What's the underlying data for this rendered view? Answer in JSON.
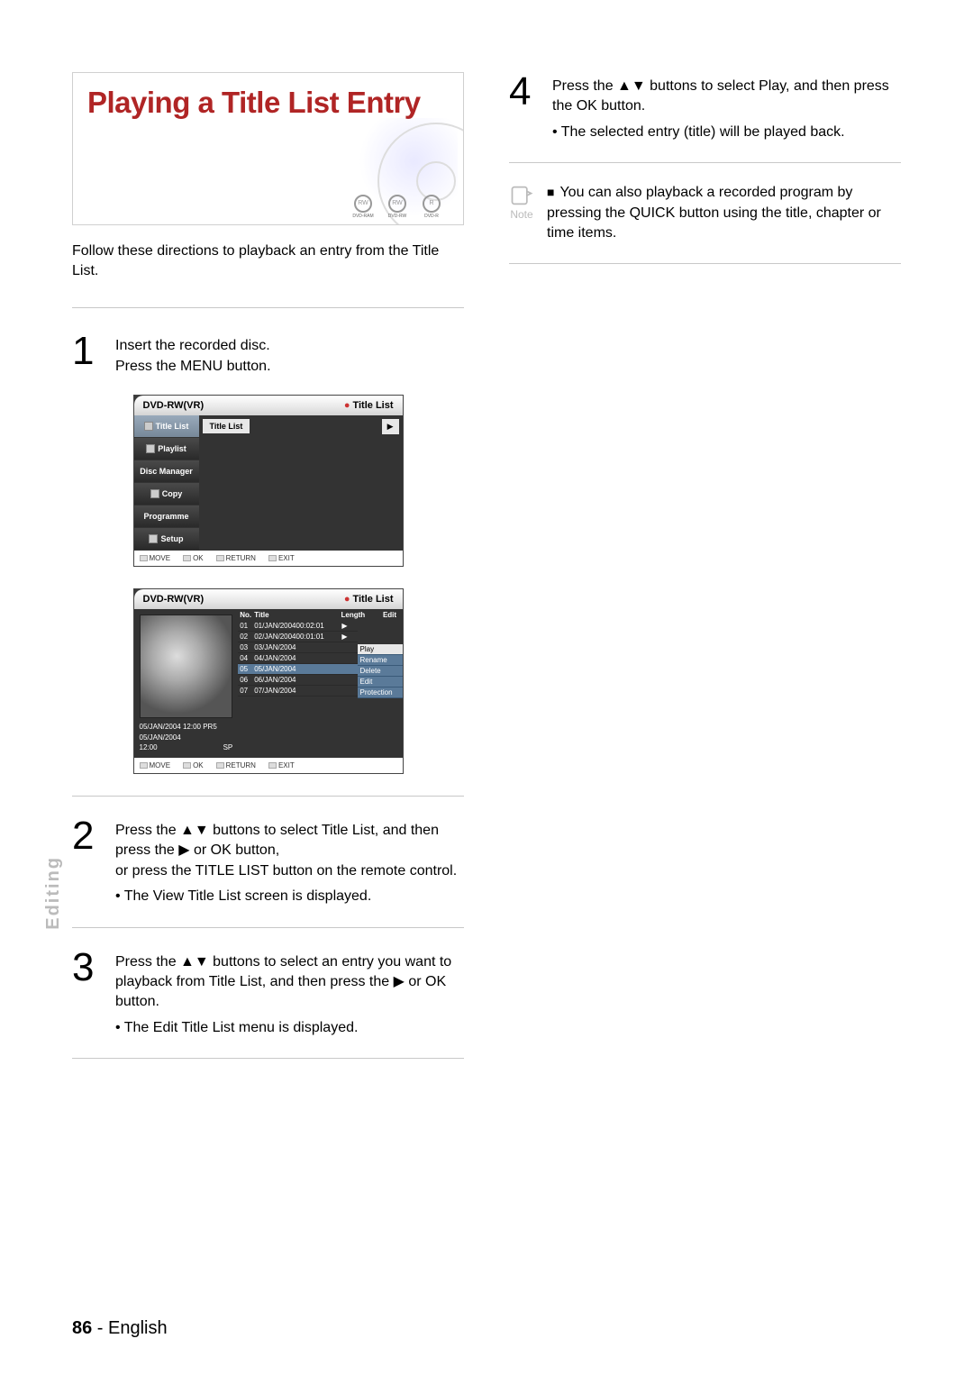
{
  "title": "Playing a Title List Entry",
  "disc_badges": [
    "DVD-RAM",
    "DVD-RW",
    "DVD-R"
  ],
  "intro": "Follow these directions to playback an entry from the Title List.",
  "steps": {
    "s1": {
      "num": "1",
      "l1": "Insert the recorded disc.",
      "l2": "Press the MENU button."
    },
    "s2": {
      "num": "2",
      "l1": "Press the ▲▼ buttons to select Title List, and then press the ▶ or OK button,",
      "l2": "or press the TITLE LIST button on the remote control.",
      "b1": "• The View Title List screen is displayed."
    },
    "s3": {
      "num": "3",
      "l1": "Press the ▲▼ buttons to select an entry you want to playback from Title List, and then press the ▶ or OK button.",
      "b1": "• The Edit Title List menu is displayed."
    },
    "s4": {
      "num": "4",
      "l1": "Press the ▲▼ buttons to select Play, and then press the OK button.",
      "b1": "• The selected entry (title) will be played back."
    }
  },
  "note": {
    "label": "Note",
    "text": "You can also playback a recorded program by pressing the QUICK button using the title, chapter or time items."
  },
  "osd1": {
    "device": "DVD-RW(VR)",
    "header": "Title List",
    "side": [
      "Title List",
      "Playlist",
      "Disc Manager",
      "Copy",
      "Programme",
      "Setup"
    ],
    "tab": "Title List",
    "bottom": [
      "MOVE",
      "OK",
      "RETURN",
      "EXIT"
    ]
  },
  "osd2": {
    "device": "DVD-RW(VR)",
    "header": "Title List",
    "cols": {
      "no": "No.",
      "title": "Title",
      "len": "Length",
      "edit": "Edit"
    },
    "rows": [
      {
        "no": "01",
        "title": "01/JAN/2004",
        "len": "00:02:01",
        "edit": "▶"
      },
      {
        "no": "02",
        "title": "02/JAN/2004",
        "len": "00:01:01",
        "edit": "▶"
      },
      {
        "no": "03",
        "title": "03/JAN/2004"
      },
      {
        "no": "04",
        "title": "04/JAN/2004"
      },
      {
        "no": "05",
        "title": "05/JAN/2004"
      },
      {
        "no": "06",
        "title": "06/JAN/2004"
      },
      {
        "no": "07",
        "title": "07/JAN/2004"
      }
    ],
    "context": [
      "Play",
      "Rename",
      "Delete",
      "Edit",
      "Protection"
    ],
    "meta": {
      "line1": "05/JAN/2004 12:00 PR5",
      "line2": "05/JAN/2004",
      "time": "12:00",
      "mode": "SP"
    },
    "bottom": [
      "MOVE",
      "OK",
      "RETURN",
      "EXIT"
    ]
  },
  "sidetab": "Editing",
  "footer": {
    "page": "86",
    "sep": " - ",
    "lang": "English"
  }
}
